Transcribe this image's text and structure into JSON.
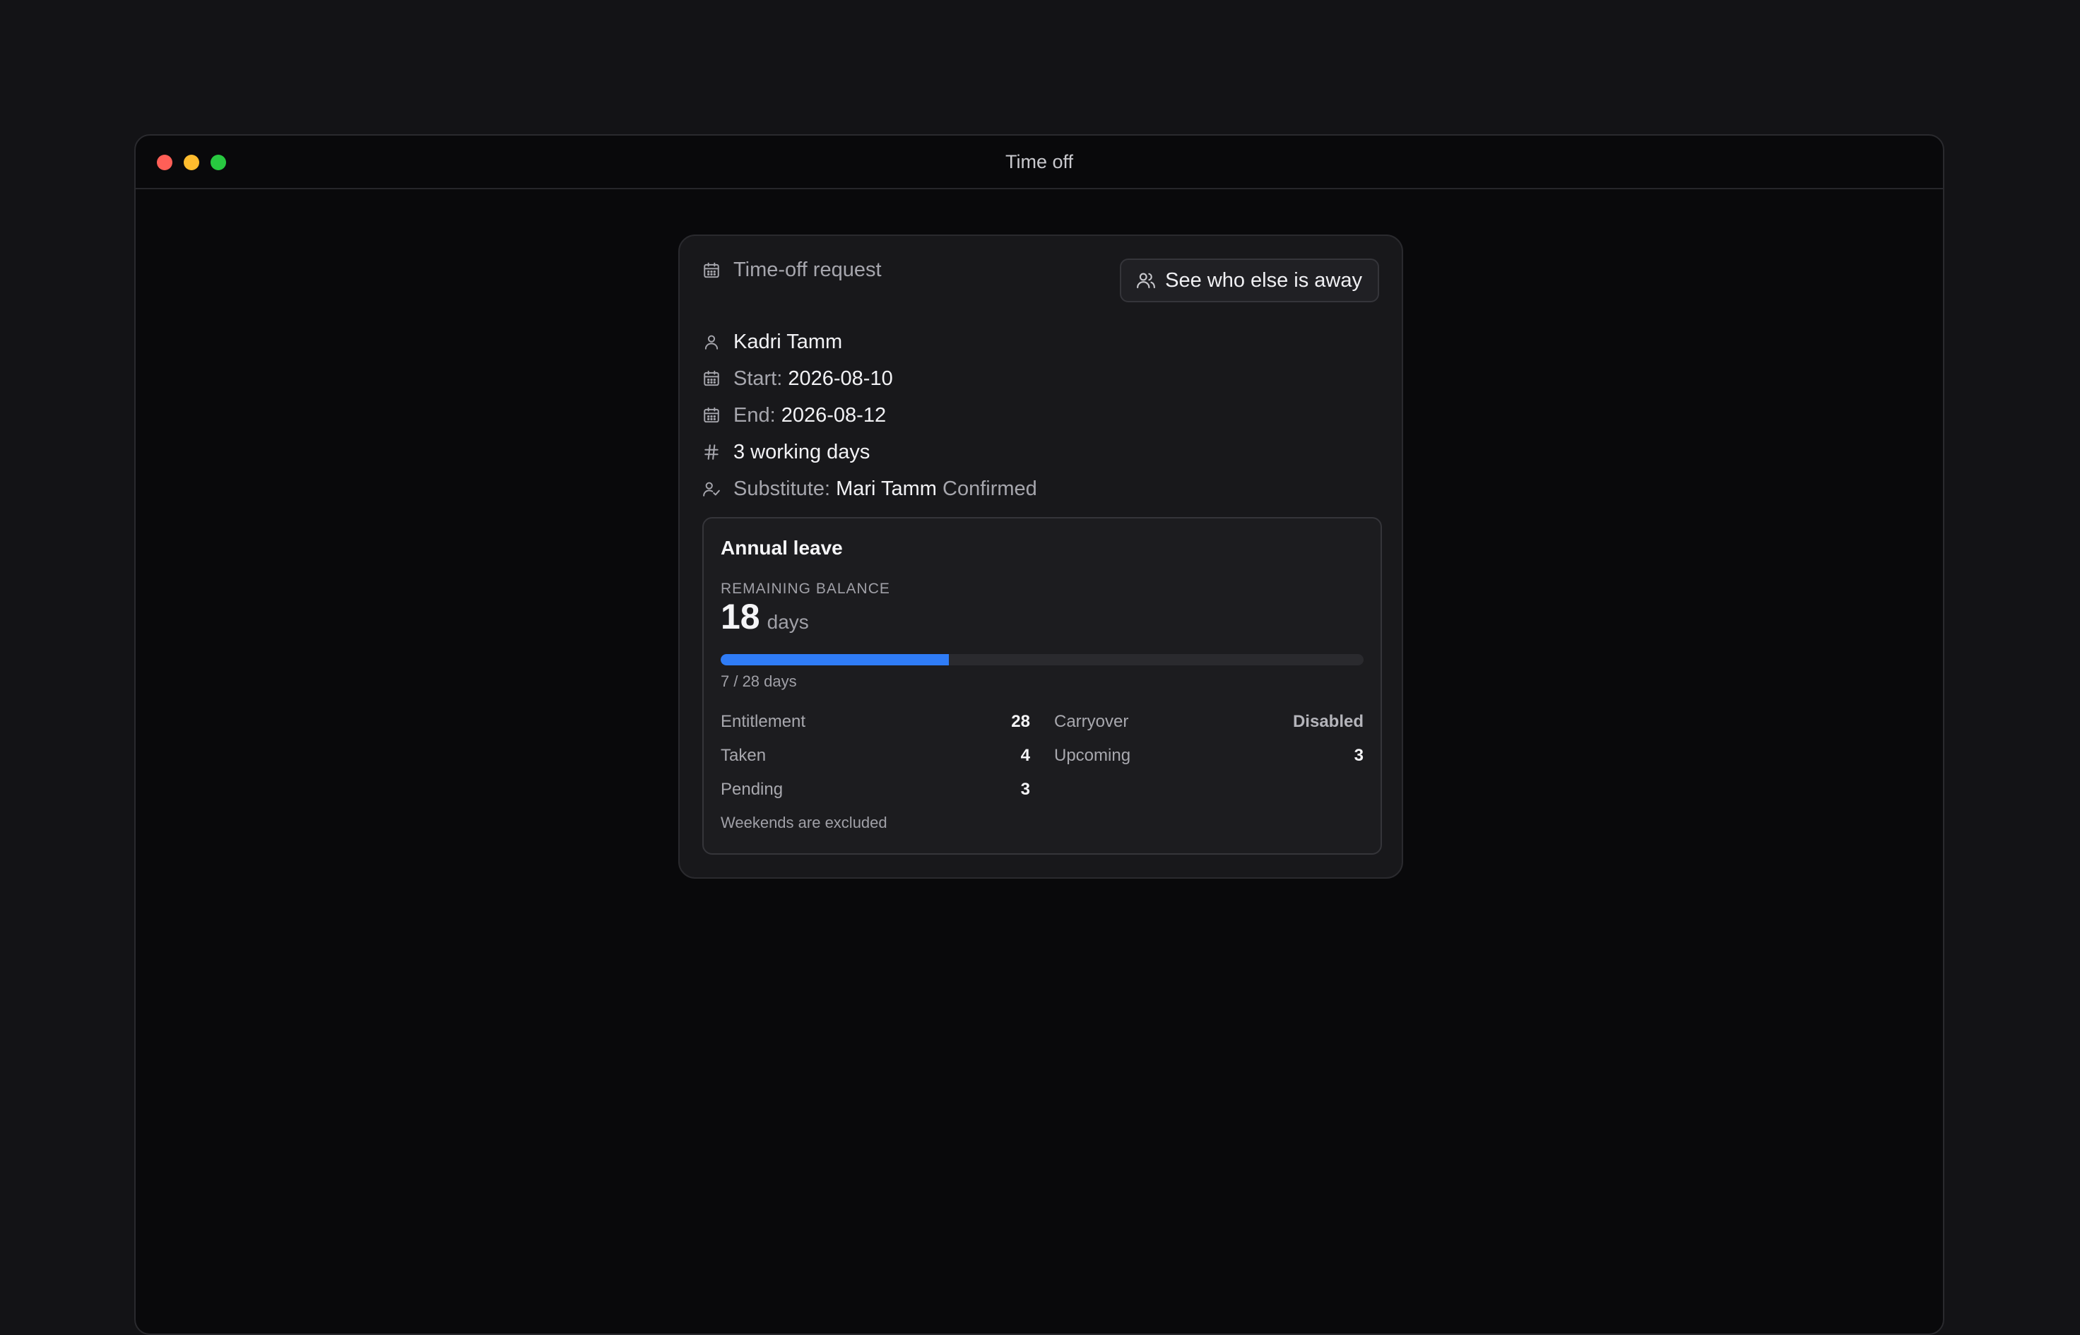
{
  "window": {
    "title": "Time off",
    "traffic_lights": [
      "#ff5f57",
      "#febc2e",
      "#28c840"
    ]
  },
  "card": {
    "header_icon": "calendar-icon",
    "title": "Time-off request",
    "away_button": {
      "icon": "users-icon",
      "label": "See who else is away"
    },
    "employee": {
      "icon": "user-icon",
      "name": "Kadri Tamm"
    },
    "start": {
      "icon": "calendar-icon",
      "label": "Start:",
      "value": "2026-08-10"
    },
    "end": {
      "icon": "calendar-icon",
      "label": "End:",
      "value": "2026-08-12"
    },
    "duration": {
      "icon": "hash-icon",
      "text": "3 working days"
    },
    "substitute": {
      "icon": "user-check-icon",
      "label": "Substitute:",
      "name": "Mari Tamm",
      "status": "Confirmed"
    }
  },
  "leave": {
    "title": "Annual leave",
    "balance_label": "REMAINING BALANCE",
    "balance_value": "18",
    "balance_unit": "days",
    "progress": {
      "used": 7,
      "total": 28,
      "fraction": 0.25,
      "color": "#2f7cf6"
    },
    "progress_caption": "7 / 28 days",
    "stats_left": [
      {
        "label": "Entitlement",
        "value": "28"
      },
      {
        "label": "Taken",
        "value": "4"
      },
      {
        "label": "Pending",
        "value": "3"
      }
    ],
    "stats_right": [
      {
        "label": "Carryover",
        "value": "Disabled"
      },
      {
        "label": "Upcoming",
        "value": "3"
      }
    ],
    "footnote": "Weekends are excluded"
  }
}
